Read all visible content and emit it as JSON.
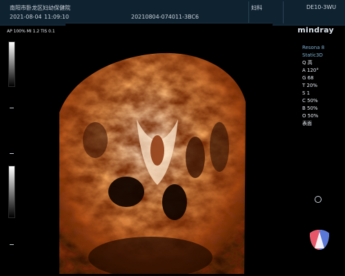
{
  "header": {
    "hospital": "南阳市卧龙区妇幼保健院",
    "date": "2021-08-04",
    "time": "11:09:10",
    "exam_id": "20210804-074011-3BC6",
    "department": "妇科",
    "probe": "DE10-3WU"
  },
  "acq_params": "AP 100%  MI 1.2 TIS 0.1",
  "brand": "mindray",
  "side_params": {
    "model": "Resona 8",
    "mode": "Static3D",
    "items": [
      "Q 高",
      "A 120°",
      "G 68",
      "T 20%",
      "S 1",
      "C 50%",
      "B 50%",
      "O 50%",
      "表面"
    ]
  },
  "colors": {
    "header_bg": "#0f2230",
    "accent": "#7fb3d6",
    "render_dark": "#2a0f03",
    "render_mid": "#b14d14",
    "render_light": "#fff1de"
  },
  "icons": {
    "scroll_indicator": "circle-icon",
    "probe_orientation": "probe-orientation-icon"
  }
}
